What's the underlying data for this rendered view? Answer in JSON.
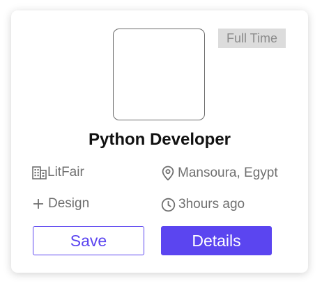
{
  "job": {
    "employment_type": "Full Time",
    "title": "Python Developer",
    "company": "LitFair",
    "location": "Mansoura, Egypt",
    "category": "Design",
    "posted": "3hours ago"
  },
  "actions": {
    "save_label": "Save",
    "details_label": "Details"
  },
  "icons": {
    "company": "building-icon",
    "location": "map-pin-icon",
    "category": "plus-icon",
    "time": "clock-icon"
  },
  "colors": {
    "accent": "#5b45f0",
    "badge_background": "#dcdcdc",
    "badge_text": "#8a8a8a",
    "meta_text": "#6f6f6f"
  }
}
